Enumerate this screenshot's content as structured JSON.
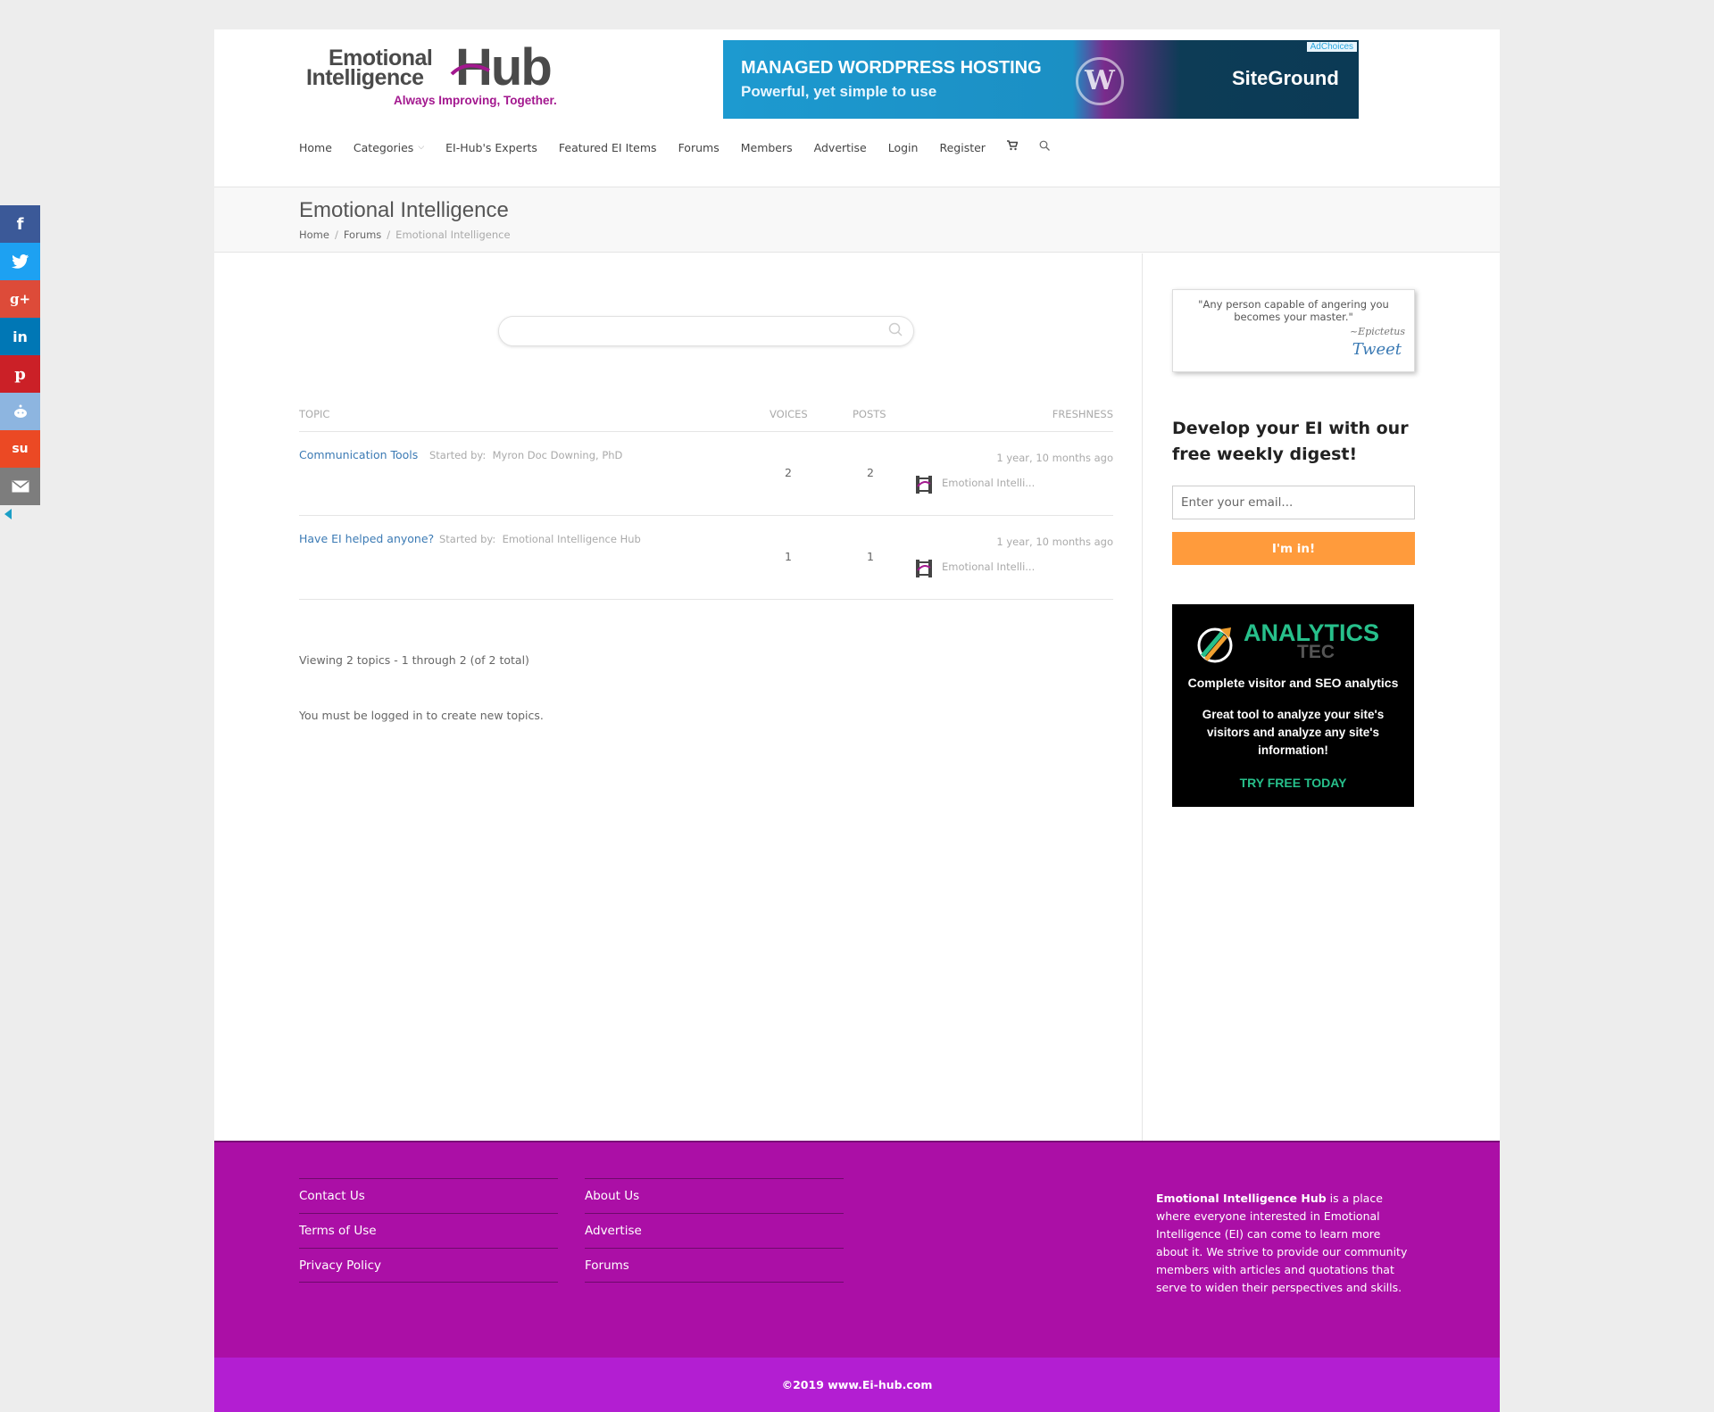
{
  "logo": {
    "line1": "Emotional",
    "line2": "Intelligence",
    "hub": "Hub",
    "tagline": "Always Improving, Together."
  },
  "header_ad": {
    "headline": "MANAGED WORDPRESS HOSTING",
    "subline": "Powerful, yet simple to use",
    "brand": "SiteGround",
    "adchoices": "AdChoices"
  },
  "nav": {
    "items": [
      "Home",
      "Categories",
      "EI-Hub's Experts",
      "Featured EI Items",
      "Forums",
      "Members",
      "Advertise",
      "Login",
      "Register"
    ],
    "cart_icon": "shopping-cart-icon",
    "search_icon": "search-icon"
  },
  "page": {
    "title": "Emotional Intelligence",
    "breadcrumb": [
      "Home",
      "Forums",
      "Emotional Intelligence"
    ]
  },
  "search": {
    "placeholder": ""
  },
  "forum": {
    "columns": {
      "topic": "TOPIC",
      "voices": "VOICES",
      "posts": "POSTS",
      "freshness": "FRESHNESS"
    },
    "started_by_label": "Started by:",
    "topics": [
      {
        "title": "Communication Tools",
        "author": "Myron Doc Downing, PhD",
        "voices": "2",
        "posts": "2",
        "freshness": "1 year, 10 months ago",
        "last_user": "Emotional Intelli..."
      },
      {
        "title": "Have EI helped anyone?",
        "author": "Emotional Intelligence Hub",
        "voices": "1",
        "posts": "1",
        "freshness": "1 year, 10 months ago",
        "last_user": "Emotional Intelli..."
      }
    ],
    "pagination": "Viewing 2 topics - 1 through 2 (of 2 total)",
    "notice": "You must be logged in to create new topics."
  },
  "sidebar": {
    "quote": {
      "text": "\"Any person capable of angering you becomes your master.\"",
      "author": "~Epictetus",
      "tweet": "Tweet"
    },
    "newsletter": {
      "heading": "Develop your EI with our free weekly digest!",
      "placeholder": "Enter your email...",
      "button": "I'm in!"
    },
    "ad": {
      "brand": "ANALYTICS",
      "brand_sub": "TEC",
      "line1": "Complete visitor and SEO analytics",
      "line2": "Great tool to analyze your site's visitors and analyze any site's information!",
      "cta": "TRY FREE TODAY"
    }
  },
  "footer": {
    "col1": [
      "Contact Us",
      "Terms of Use",
      "Privacy Policy"
    ],
    "col2": [
      "About Us",
      "Advertise",
      "Forums"
    ],
    "about_bold": "Emotional Intelligence Hub",
    "about_rest": " is a place where everyone interested in Emotional Intelligence (EI) can come to learn more about it. We strive to provide our community members with articles and quotations that serve to widen their perspectives and skills.",
    "copyright": "©2019 www.Ei-hub.com"
  },
  "social": {
    "buttons": [
      {
        "name": "facebook-icon",
        "glyph": "f",
        "color": "#3b5998"
      },
      {
        "name": "twitter-icon",
        "glyph": "t",
        "color": "#1da1f2"
      },
      {
        "name": "google-plus-icon",
        "glyph": "g+",
        "color": "#dd4b39"
      },
      {
        "name": "linkedin-icon",
        "glyph": "in",
        "color": "#0077b5"
      },
      {
        "name": "pinterest-icon",
        "glyph": "p",
        "color": "#cb2027"
      },
      {
        "name": "reddit-icon",
        "glyph": "☺",
        "color": "#8db5e0"
      },
      {
        "name": "stumbleupon-icon",
        "glyph": "su",
        "color": "#eb4924"
      },
      {
        "name": "email-icon",
        "glyph": "✉",
        "color": "#7d7d7d"
      }
    ]
  },
  "colors": {
    "footer": "#ab0fa6",
    "copyright_bar": "#b31ed2",
    "accent_button": "#ff9b3c",
    "link": "#3b7ab4"
  }
}
